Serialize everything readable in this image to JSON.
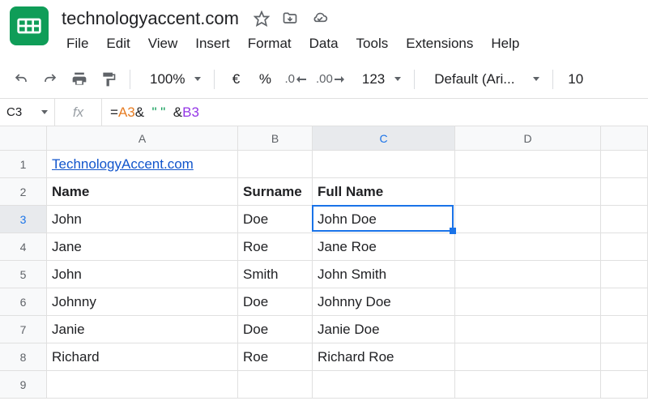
{
  "doc_title": "technologyaccent.com",
  "menu": {
    "file": "File",
    "edit": "Edit",
    "view": "View",
    "insert": "Insert",
    "format": "Format",
    "data": "Data",
    "tools": "Tools",
    "extensions": "Extensions",
    "help": "Help"
  },
  "toolbar": {
    "zoom": "100%",
    "currency": "€",
    "percent": "%",
    "dec_dec": ".0",
    "inc_dec": ".00",
    "num_fmt": "123",
    "font": "Default (Ari...",
    "font_size": "10"
  },
  "name_box": "C3",
  "formula_parts": {
    "eq": "=",
    "a": "A3",
    "amp1": "&",
    "str": "\"  \"",
    "amp2": "&",
    "b": "B3",
    "space": "  "
  },
  "columns": [
    "A",
    "B",
    "C",
    "D",
    ""
  ],
  "rows": [
    "1",
    "2",
    "3",
    "4",
    "5",
    "6",
    "7",
    "8",
    "9"
  ],
  "sheet": [
    {
      "a": "TechnologyAccent.com",
      "b": "",
      "c": "",
      "d": "",
      "e": "",
      "a_link": true
    },
    {
      "a": "Name",
      "b": "Surname",
      "c": "Full Name",
      "d": "",
      "e": "",
      "bold": true
    },
    {
      "a": "John",
      "b": "Doe",
      "c": "John Doe",
      "d": "",
      "e": ""
    },
    {
      "a": "Jane",
      "b": "Roe",
      "c": "Jane Roe",
      "d": "",
      "e": ""
    },
    {
      "a": "John",
      "b": "Smith",
      "c": "John Smith",
      "d": "",
      "e": ""
    },
    {
      "a": "Johnny",
      "b": "Doe",
      "c": "Johnny Doe",
      "d": "",
      "e": ""
    },
    {
      "a": "Janie",
      "b": "Doe",
      "c": "Janie Doe",
      "d": "",
      "e": ""
    },
    {
      "a": "Richard",
      "b": "Roe",
      "c": "Richard Roe",
      "d": "",
      "e": ""
    },
    {
      "a": "",
      "b": "",
      "c": "",
      "d": "",
      "e": ""
    }
  ],
  "selected": {
    "row_index": 2,
    "col": "C"
  }
}
